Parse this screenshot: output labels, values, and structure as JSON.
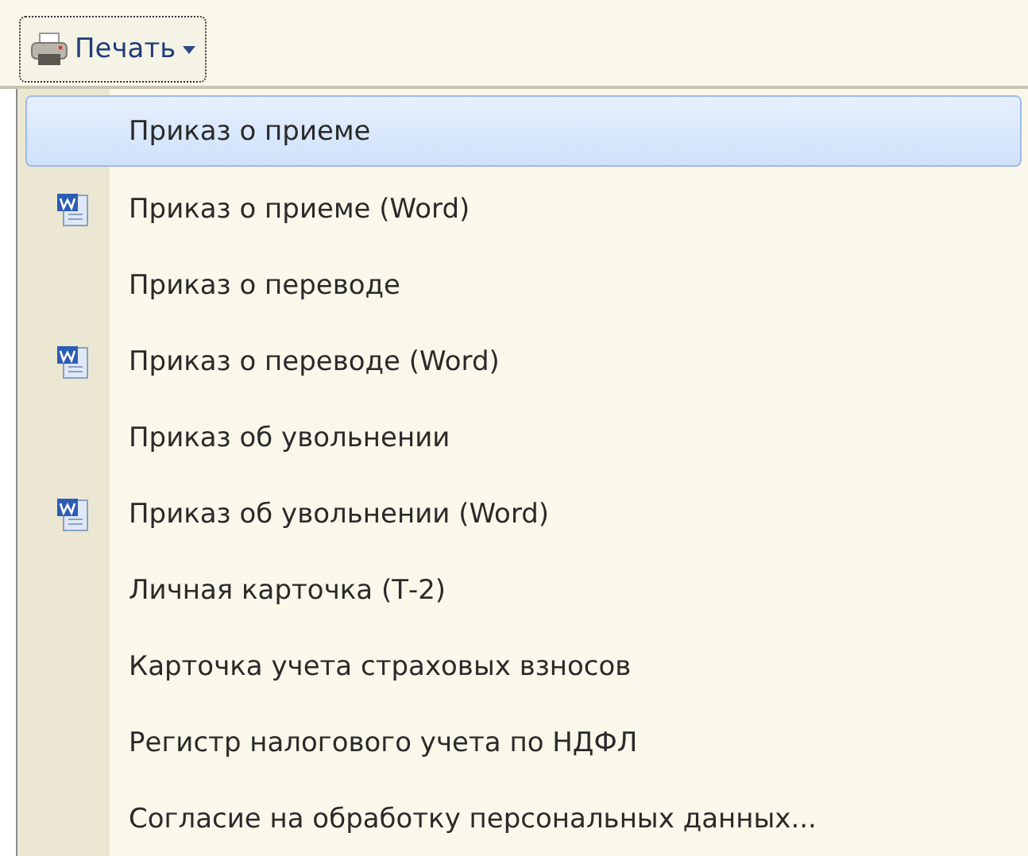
{
  "toolbar": {
    "print_button": {
      "label": "Печать"
    }
  },
  "menu": {
    "items": [
      {
        "label": "Приказ о приеме",
        "kind": "plain",
        "selected": true
      },
      {
        "label": "Приказ о приеме (Word)",
        "kind": "word",
        "selected": false
      },
      {
        "label": "Приказ о переводе",
        "kind": "plain",
        "selected": false
      },
      {
        "label": "Приказ о переводе (Word)",
        "kind": "word",
        "selected": false
      },
      {
        "label": "Приказ об увольнении",
        "kind": "plain",
        "selected": false
      },
      {
        "label": "Приказ об увольнении (Word)",
        "kind": "word",
        "selected": false
      },
      {
        "label": "Личная карточка (Т-2)",
        "kind": "plain",
        "selected": false
      },
      {
        "label": "Карточка учета страховых взносов",
        "kind": "plain",
        "selected": false
      },
      {
        "label": "Регистр налогового учета по НДФЛ",
        "kind": "plain",
        "selected": false
      },
      {
        "label": "Согласие на обработку персональных данных...",
        "kind": "plain",
        "selected": false
      }
    ]
  }
}
